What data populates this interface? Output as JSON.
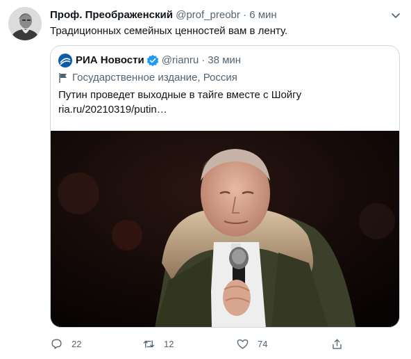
{
  "tweet": {
    "author_name": "Проф. Преображенский",
    "author_handle": "@prof_preobr",
    "separator": "·",
    "time": "6 мин",
    "text": "Традиционных семейных ценностей вам в ленту.",
    "avatar_icon": "portrait-avatar",
    "more_icon": "more-icon"
  },
  "quote": {
    "author_name": "РИА Новости",
    "author_handle": "@rianru",
    "separator": "·",
    "time": "38 мин",
    "verified_icon": "verified-badge-icon",
    "logo_icon": "ria-logo",
    "label_icon": "flag-icon",
    "label": "Государственное издание, Россия",
    "text": "Путин проведет выходные в тайге вместе с Шойгу",
    "link": "ria.ru/20210319/putin…",
    "image": "photo-man-parka-microphone"
  },
  "actions": {
    "reply_count": "22",
    "retweet_count": "12",
    "like_count": "74",
    "reply_icon": "reply-icon",
    "retweet_icon": "retweet-icon",
    "like_icon": "heart-icon",
    "share_icon": "share-icon"
  },
  "colors": {
    "text": "#0f1419",
    "secondary": "#536471",
    "border": "#cfd9de",
    "verified": "#1d9bf0",
    "ria_blue": "#0a5ca9"
  }
}
